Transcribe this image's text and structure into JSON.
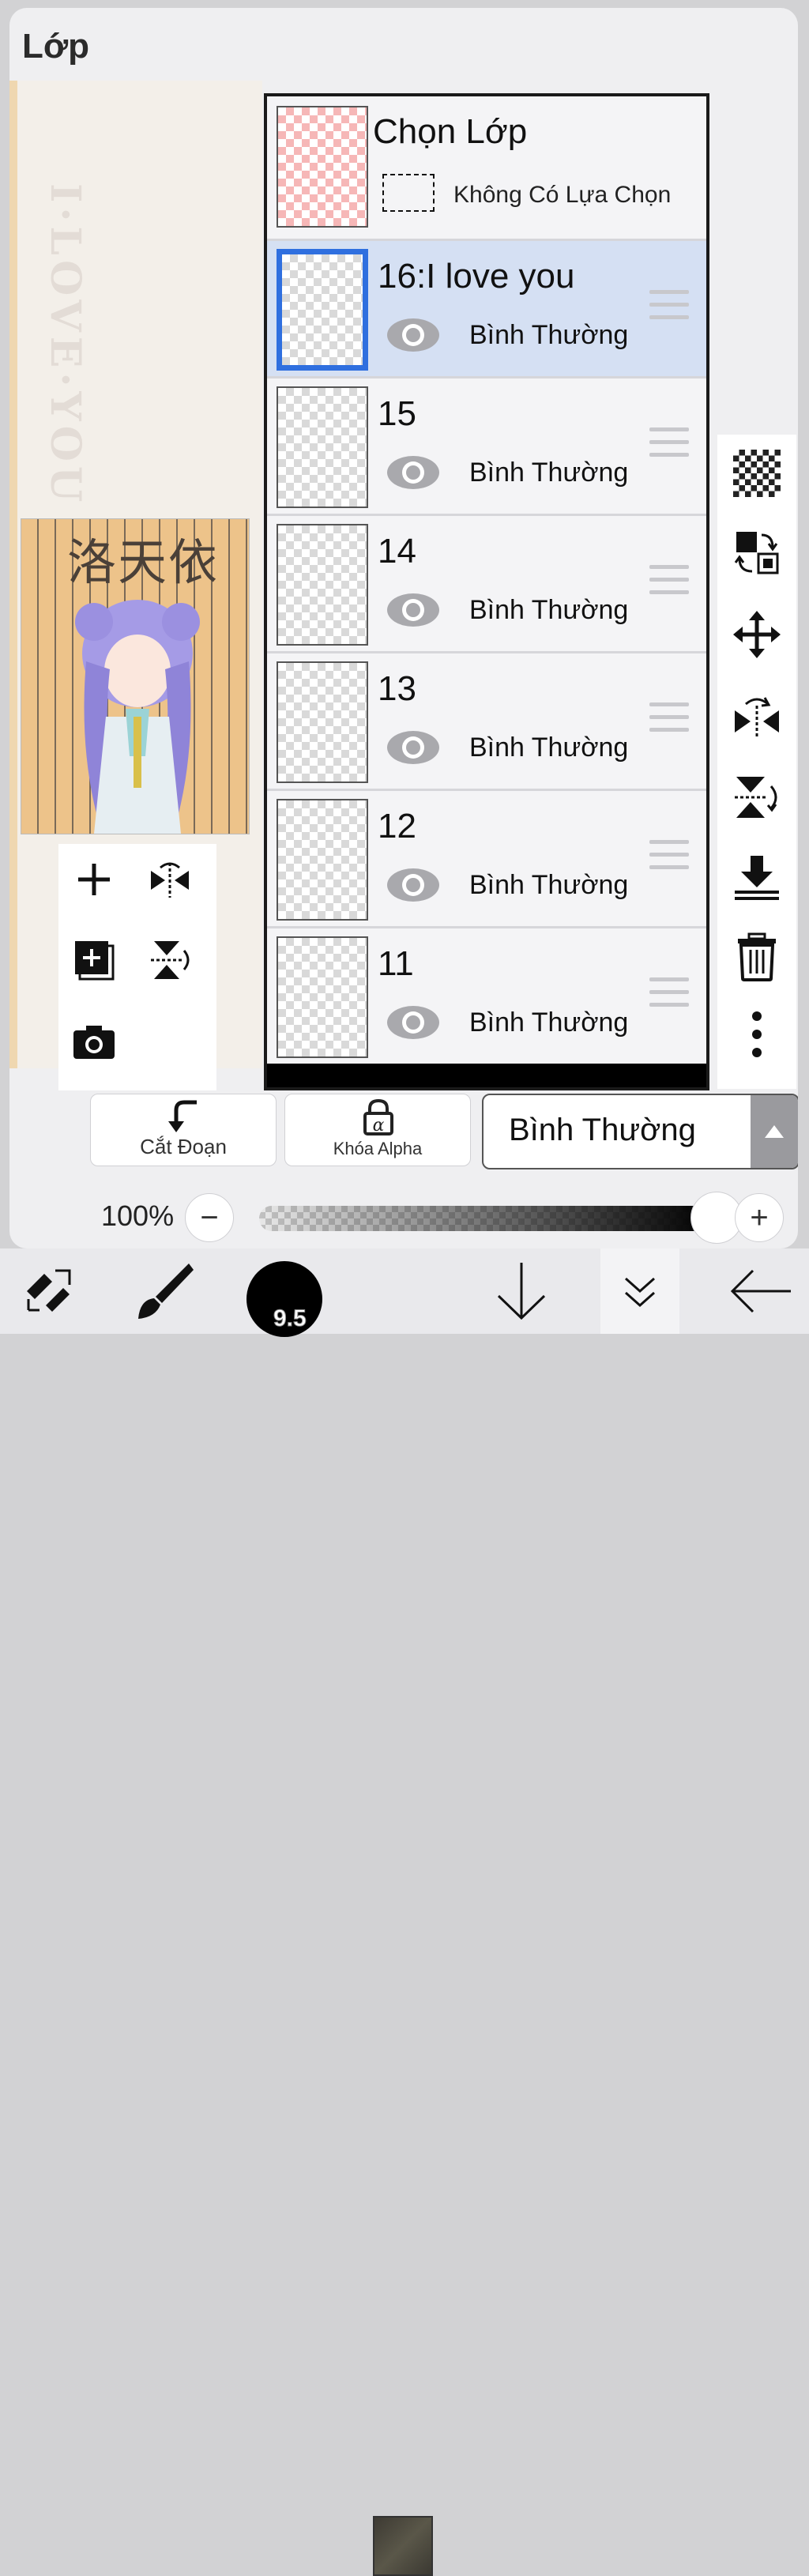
{
  "panel": {
    "title": "Lớp"
  },
  "canvas": {
    "thumbnail_text": "洛天依"
  },
  "selection": {
    "title": "Chọn Lớp",
    "status": "Không Có Lựa Chọn"
  },
  "layers": [
    {
      "name": "16:I love you",
      "blend": "Bình Thường",
      "active": true
    },
    {
      "name": "15",
      "blend": "Bình Thường",
      "active": false
    },
    {
      "name": "14",
      "blend": "Bình Thường",
      "active": false
    },
    {
      "name": "13",
      "blend": "Bình Thường",
      "active": false
    },
    {
      "name": "12",
      "blend": "Bình Thường",
      "active": false
    },
    {
      "name": "11",
      "blend": "Bình Thường",
      "active": false
    }
  ],
  "bottom": {
    "clip_label": "Cắt Đoạn",
    "alpha_lock_label": "Khóa Alpha",
    "blend_mode": "Bình Thường",
    "opacity_label": "100%",
    "opacity_value": 1.0
  },
  "toolbar": {
    "brush_size": "9.5"
  },
  "icons": [
    "add-layer-icon",
    "flip-horizontal-icon",
    "duplicate-layer-icon",
    "flip-vertical-icon",
    "camera-icon",
    "checker-icon",
    "swap-icon",
    "move-icon",
    "mirror-icon",
    "rotate-flip-icon",
    "merge-down-icon",
    "trash-icon",
    "more-icon",
    "transform-icon",
    "brush-icon",
    "down-arrow-icon",
    "double-chevron-icon",
    "back-arrow-icon"
  ],
  "colors": {
    "accent": "#2f6fdf",
    "active_row": "#d5e0f3",
    "current_color": "#4a4740"
  }
}
